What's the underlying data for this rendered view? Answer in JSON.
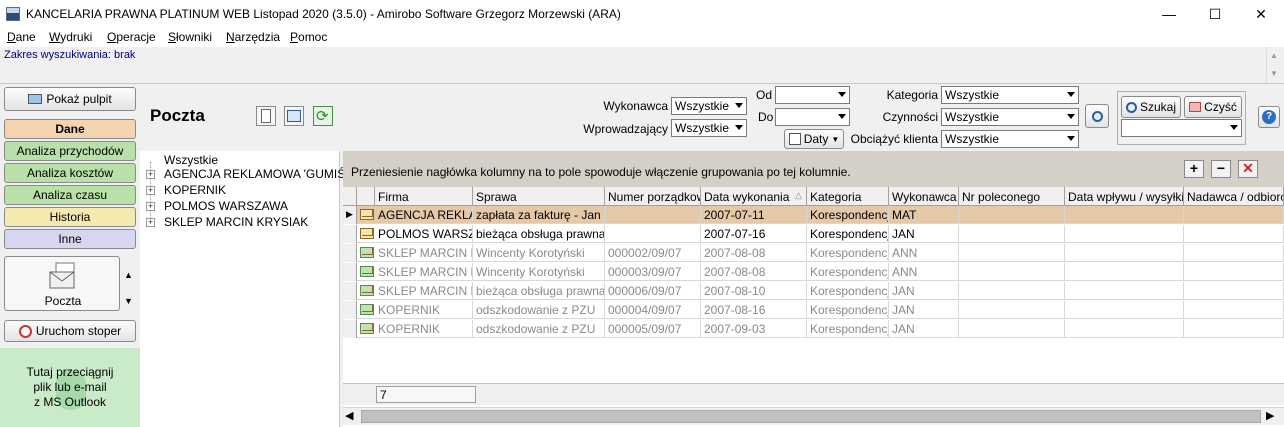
{
  "window": {
    "title": "KANCELARIA PRAWNA PLATINUM WEB Listopad 2020 (3.5.0)  -  Amirobo Software Grzegorz Morzewski  (ARA)",
    "minimize": "—",
    "maximize": "☐",
    "close": "✕"
  },
  "menu": [
    "Dane",
    "Wydruki",
    "Operacje",
    "Słowniki",
    "Narzędzia",
    "Pomoc"
  ],
  "search_range": "Zakres wyszukiwania: brak",
  "sidebar": {
    "pulpit": "Pokaż pulpit",
    "dane": "Dane",
    "przychody": "Analiza przychodów",
    "koszty": "Analiza kosztów",
    "czas": "Analiza czasu",
    "historia": "Historia",
    "inne": "Inne",
    "poczta": "Poczta",
    "stoper": "Uruchom stoper",
    "dropzone": "Tutaj przeciągnij\nplik lub e-mail\nz MS Outlook"
  },
  "header": {
    "title": "Poczta",
    "wykonawca_label": "Wykonawca",
    "wykonawca_value": "Wszystkie",
    "wprowadzajacy_label": "Wprowadzający",
    "wprowadzajacy_value": "Wszystkie",
    "od_label": "Od",
    "do_label": "Do",
    "od_value": "",
    "do_value": "",
    "daty_label": "Daty",
    "kategoria_label": "Kategoria",
    "kategoria_value": "Wszystkie",
    "czynnosci_label": "Czynności",
    "czynnosci_value": "Wszystkie",
    "obciazyc_label": "Obciążyć klienta",
    "obciazyc_value": "Wszystkie",
    "szukaj": "Szukaj",
    "czysc": "Czyść",
    "saved_search_value": ""
  },
  "tree": {
    "root": "Wszystkie",
    "items": [
      "AGENCJA REKLAMOWA 'GUMIŚ'",
      "KOPERNIK",
      "POLMOS WARSZAWA",
      "SKLEP MARCIN KRYSIAK"
    ]
  },
  "grid": {
    "group_hint": "Przeniesienie nagłówka kolumny na to pole spowoduje włączenie grupowania po tej kolumnie.",
    "columns": [
      "Firma",
      "Sprawa",
      "Numer porządkowy",
      "Data wykonania",
      "Kategoria",
      "Wykonawca",
      "Nr poleconego",
      "Data wpływu / wysyłki",
      "Nadawca / odbiorca"
    ],
    "sort_indicator": "△",
    "rows": [
      [
        "AGENCJA REKLAM",
        "zapłata za fakturę - Jan Co",
        "",
        "2007-07-11",
        "Korespondencja",
        "MAT",
        "",
        "",
        ""
      ],
      [
        "POLMOS WARSZA",
        "bieżąca obsługa prawna - ",
        "",
        "2007-07-16",
        "Korespondencja",
        "JAN",
        "",
        "",
        ""
      ],
      [
        "SKLEP MARCIN KF",
        "Wincenty Korotyński",
        "000002/09/07",
        "2007-08-08",
        "Korespondencja",
        "ANN",
        "",
        "",
        ""
      ],
      [
        "SKLEP MARCIN KF",
        "Wincenty Korotyński",
        "000003/09/07",
        "2007-08-08",
        "Korespondencja",
        "ANN",
        "",
        "",
        ""
      ],
      [
        "SKLEP MARCIN KF",
        "bieżąca obsługa prawna - ",
        "000006/09/07",
        "2007-08-10",
        "Korespondencja",
        "JAN",
        "",
        "",
        ""
      ],
      [
        "KOPERNIK",
        "odszkodowanie z PZU",
        "000004/09/07",
        "2007-08-16",
        "Korespondencja",
        "JAN",
        "",
        "",
        ""
      ],
      [
        "KOPERNIK",
        "odszkodowanie z PZU",
        "000005/09/07",
        "2007-09-03",
        "Korespondencja",
        "JAN",
        "",
        "",
        ""
      ]
    ],
    "row_count": "7",
    "current_row_marker": "▶"
  }
}
